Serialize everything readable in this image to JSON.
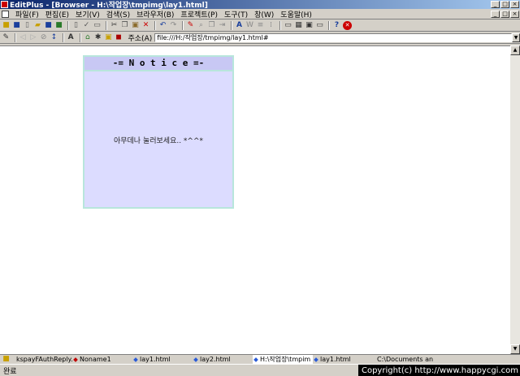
{
  "window": {
    "title": "EditPlus - [Browser - H:\\작업장\\tmpimg\\lay1.html]",
    "controls": [
      "_",
      "□",
      "×"
    ]
  },
  "menubar": {
    "items": [
      "파일(F)",
      "편집(E)",
      "보기(V)",
      "검색(S)",
      "브라우저(B)",
      "프로젝트(P)",
      "도구(T)",
      "창(W)",
      "도움말(H)"
    ],
    "mdi_controls": [
      "_",
      "□",
      "×"
    ]
  },
  "toolbar1": {
    "icons": [
      "open-folder-icon",
      "save-icon",
      "new-file-icon",
      "open-icon",
      "save-all-icon",
      "print-icon",
      "print-preview-icon",
      "spellcheck-icon",
      "page-icon",
      "cut-icon",
      "copy-icon",
      "paste-icon",
      "delete-icon",
      "undo-icon",
      "redo-icon",
      "find-icon",
      "replace-icon",
      "goto-icon",
      "word-wrap-icon",
      "font-icon",
      "ruler-icon",
      "line-number-icon",
      "column-icon",
      "window-icon",
      "tile-icon",
      "browser-icon",
      "help-icon",
      "stop-icon"
    ]
  },
  "toolbar2": {
    "address_label": "주소(A)",
    "address_value": "file:///H:/작업장/tmpimg/lay1.html#"
  },
  "notice": {
    "header": "-= N o t i c e =-",
    "body": "아무데나 눌러보세요.. *^^*"
  },
  "tabs": [
    {
      "label": "kspayFAuthReply.p",
      "color": "#2a5bd7",
      "active": false
    },
    {
      "label": "Noname1",
      "color": "#c00000",
      "active": false
    },
    {
      "label": "lay1.html",
      "color": "#2a5bd7",
      "active": false
    },
    {
      "label": "lay2.html",
      "color": "#2a5bd7",
      "active": false
    },
    {
      "label": "H:\\작업장\\tmpim",
      "color": "#2a5bd7",
      "active": true
    },
    {
      "label": "lay1.html",
      "color": "#2a5bd7",
      "active": false
    },
    {
      "label": "C:\\Documents an",
      "color": "#2a5bd7",
      "active": false
    }
  ],
  "status": {
    "text": "완료",
    "copyright": "Copyright(c) http://www.happycgi.com"
  }
}
